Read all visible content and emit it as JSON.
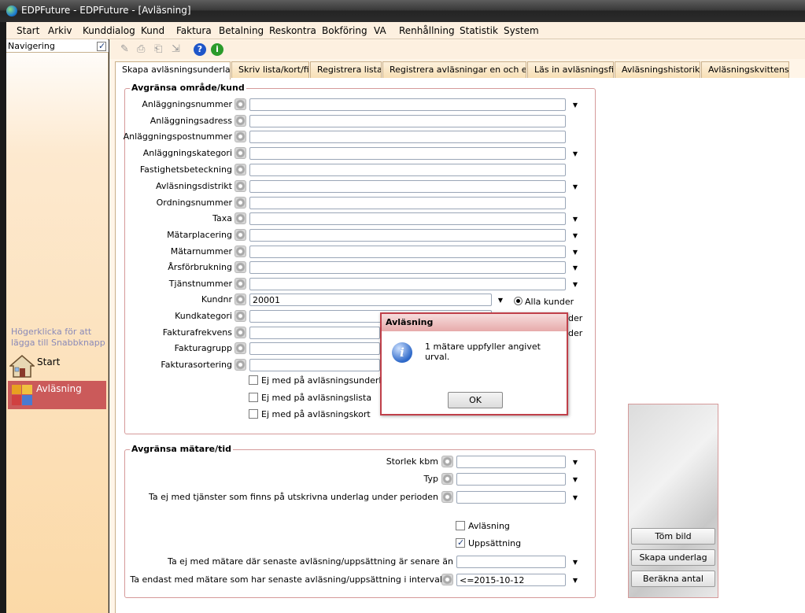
{
  "window": {
    "title": "EDPFuture - EDPFuture - [Avläsning]"
  },
  "menu": [
    "Start",
    "Arkiv",
    "Kunddialog",
    "Kund",
    "Faktura",
    "Betalning",
    "Reskontra",
    "Bokföring",
    "VA",
    "Renhållning",
    "Statistik",
    "System"
  ],
  "nav": {
    "header": "Navigering",
    "hint": "Högerklicka för att lägga till Snabbknapp",
    "items": [
      {
        "label": "Start",
        "icon": "house-icon"
      },
      {
        "label": "Avläsning",
        "icon": "meter-icon"
      }
    ]
  },
  "tabs": [
    "Skapa avläsningsunderlag",
    "Skriv lista/kort/fil",
    "Registrera lista",
    "Registrera avläsningar en och en",
    "Läs in avläsningsfil",
    "Avläsningshistorik",
    "Avläsningskvittens"
  ],
  "group1": {
    "title": "Avgränsa område/kund",
    "fields": [
      {
        "label": "Anläggningsnummer",
        "value": ""
      },
      {
        "label": "Anläggningsadress",
        "value": ""
      },
      {
        "label": "Anläggningspostnummer",
        "value": ""
      },
      {
        "label": "Anläggningskategori",
        "value": ""
      },
      {
        "label": "Fastighetsbeteckning",
        "value": ""
      },
      {
        "label": "Avläsningsdistrikt",
        "value": ""
      },
      {
        "label": "Ordningsnummer",
        "value": ""
      },
      {
        "label": "Taxa",
        "value": ""
      },
      {
        "label": "Mätarplacering",
        "value": ""
      },
      {
        "label": "Mätarnummer",
        "value": ""
      },
      {
        "label": "Årsförbrukning",
        "value": ""
      },
      {
        "label": "Tjänstnummer",
        "value": ""
      },
      {
        "label": "Kundnr",
        "value": "20001"
      },
      {
        "label": "Kundkategori",
        "value": ""
      },
      {
        "label": "Fakturafrekvens",
        "value": ""
      },
      {
        "label": "Fakturagrupp",
        "value": ""
      },
      {
        "label": "Fakturasortering",
        "value": ""
      }
    ],
    "radios": [
      {
        "label": "Alla kunder",
        "checked": true
      },
      {
        "label": "der"
      },
      {
        "label": "der"
      }
    ],
    "checkboxes": [
      {
        "label": "Ej med på avläsningsunderlag",
        "checked": false
      },
      {
        "label": "Ej med på avläsningslista",
        "checked": false
      },
      {
        "label": "Ej med på avläsningskort",
        "checked": false
      }
    ]
  },
  "group2": {
    "title": "Avgränsa mätare/tid",
    "fields": [
      {
        "label": "Storlek kbm",
        "value": ""
      },
      {
        "label": "Typ",
        "value": ""
      },
      {
        "label": "Ta ej med tjänster som finns på utskrivna underlag under perioden",
        "value": ""
      }
    ],
    "checkboxes": [
      {
        "label": "Avläsning",
        "checked": false
      },
      {
        "label": "Uppsättning",
        "checked": true
      }
    ],
    "fields2": [
      {
        "label": "Ta ej med mätare där senaste avläsning/uppsättning är senare än",
        "value": ""
      },
      {
        "label": "Ta endast med mätare som har senaste avläsning/uppsättning i intervallet",
        "value": "<=2015-10-12"
      }
    ]
  },
  "buttons": {
    "clear": "Töm bild",
    "create": "Skapa underlag",
    "count": "Beräkna antal"
  },
  "dialog": {
    "title": "Avläsning",
    "message": "1 mätare uppfyller angivet urval.",
    "ok": "OK"
  }
}
